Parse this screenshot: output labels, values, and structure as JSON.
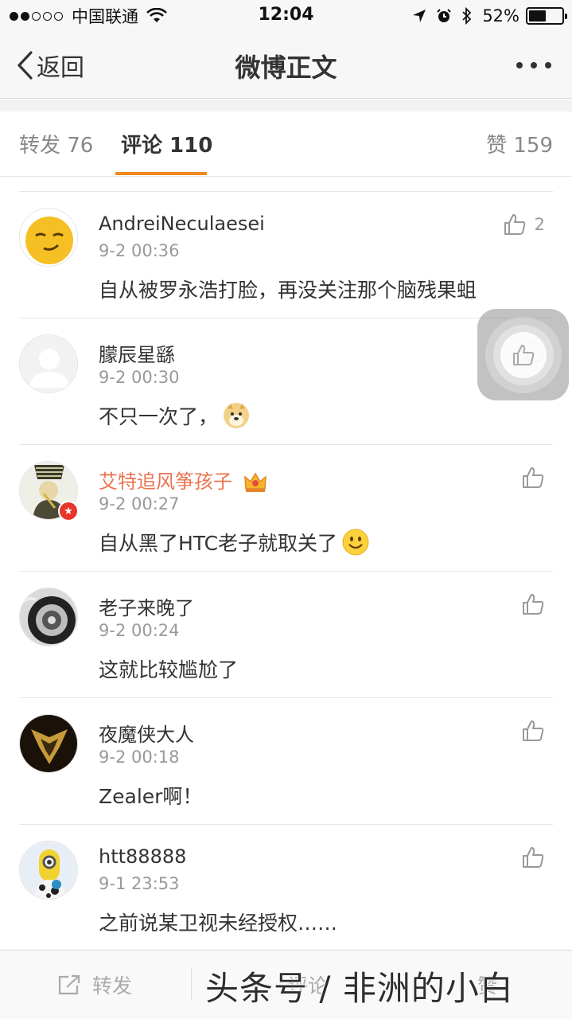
{
  "status_bar": {
    "carrier": "中国联通",
    "time": "12:04",
    "battery_percent": "52%",
    "battery_level": 0.52
  },
  "nav": {
    "back_label": "返回",
    "title": "微博正文",
    "more_icon": "more-icon"
  },
  "tabs": {
    "repost": "转发 76",
    "comment": "评论 110",
    "like": "赞 159"
  },
  "comments": [
    {
      "name": "AndreiNeculaesei",
      "time": "9-2 00:36",
      "text": "自从被罗永浩打脸，再没关注那个脑残果蛆",
      "likes": "2"
    },
    {
      "name": "朦辰星繇",
      "time": "9-2 00:30",
      "text": "不只一次了，",
      "likes": ""
    },
    {
      "name": "艾特追风筝孩子",
      "time": "9-2 00:27",
      "text": "自从黑了HTC老子就取关了",
      "likes": ""
    },
    {
      "name": "老子来晚了",
      "time": "9-2 00:24",
      "text": "这就比较尴尬了",
      "likes": ""
    },
    {
      "name": "夜魔侠大人",
      "time": "9-2 00:18",
      "text": "Zealer啊！",
      "likes": ""
    },
    {
      "name": "htt88888",
      "time": "9-1 23:53",
      "text": "之前说某卫视未经授权……",
      "likes": ""
    }
  ],
  "toolbar": {
    "repost": "转发",
    "comment": "评论",
    "like": "赞"
  },
  "watermark": "头条号 / 非洲的小白",
  "colors": {
    "accent": "#f08a1c",
    "vip_name": "#eb7350"
  }
}
